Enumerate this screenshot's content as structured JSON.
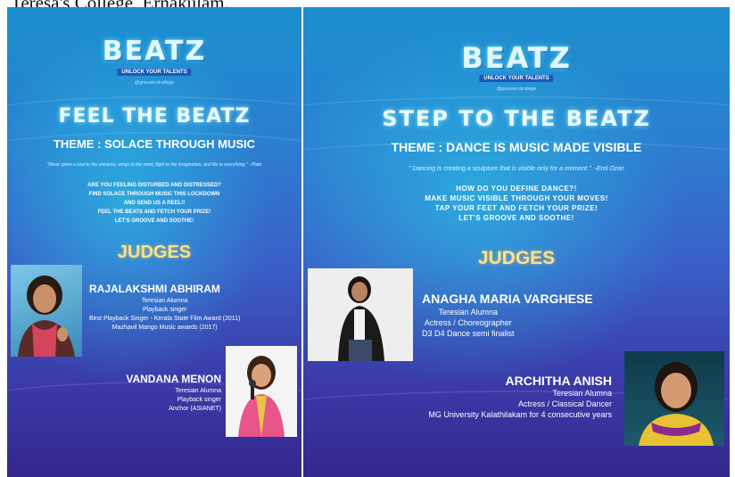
{
  "caption": "Teresa's College, Ernakulam.",
  "posters": [
    {
      "logo": "BEATZ",
      "logo_tagline": "UNLOCK YOUR TALENTS",
      "instagram": "@grooves.stcollege",
      "title": "FEEL THE BEATZ",
      "theme": "THEME : SOLACE THROUGH MUSIC",
      "quote": "\"Music gives a soul to the universe, wings to the mind, flight to the imagination, and life to everything.\" - Plato",
      "lines": [
        "ARE YOU FEELING DISTURBED AND DISTRESSED?",
        "FIND  SOLACE THROUGH MUSIC THIS LOCKDOWN",
        "AND SEND US A REEL!!",
        "FEEL THE BEATS AND FETCH YOUR PRIZE!",
        "LET'S GROOVE AND SOOTHE!"
      ],
      "judges_heading": "JUDGES",
      "judges": [
        {
          "name": "RAJALAKSHMI ABHIRAM",
          "details": [
            "Teresian Alumna",
            "Playback singer",
            "Best Playback Singer  - Kerala State Film Award (2011)",
            "Mazhavil Mango Music awards (2017)"
          ]
        },
        {
          "name": "VANDANA MENON",
          "details": [
            "Teresian Alumna",
            "Playback singer",
            "Anchor (ASIANET)"
          ]
        }
      ]
    },
    {
      "logo": "BEATZ",
      "logo_tagline": "UNLOCK YOUR TALENTS",
      "instagram": "@grooves.stcollege",
      "title": "STEP TO THE BEATZ",
      "theme": "THEME : DANCE IS MUSIC MADE VISIBLE",
      "quote": "\" Dancing is creating a sculpture that is visible only for a moment \".   -Erol Ozan",
      "lines": [
        "HOW DO YOU DEFINE DANCE?!",
        "MAKE MUSIC VISIBLE THROUGH YOUR MOVES!",
        "TAP YOUR FEET AND FETCH YOUR PRIZE!",
        "LET'S GROOVE AND SOOTHE!"
      ],
      "judges_heading": "JUDGES",
      "judges": [
        {
          "name": "ANAGHA MARIA VARGHESE",
          "details": [
            "Teresian Alumna",
            "Actress / Choreographer",
            "D3 D4 Dance semi finalist"
          ]
        },
        {
          "name": "ARCHITHA ANISH",
          "details": [
            "Teresian Alumna",
            "Actress /  Classical Dancer",
            "MG University Kalathilakam for 4 consecutive years"
          ]
        }
      ]
    }
  ]
}
